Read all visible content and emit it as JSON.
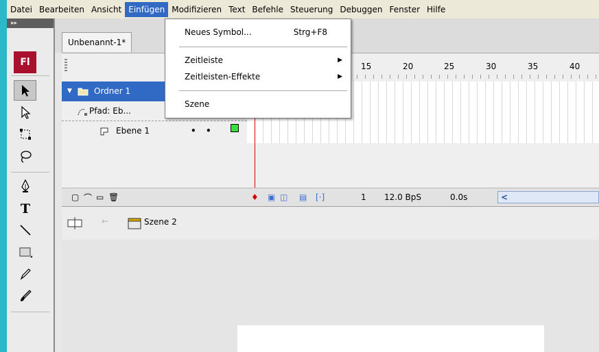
{
  "menubar": {
    "items": [
      "Datei",
      "Bearbeiten",
      "Ansicht",
      "Einfügen",
      "Modifizieren",
      "Text",
      "Befehle",
      "Steuerung",
      "Debuggen",
      "Fenster",
      "Hilfe"
    ],
    "active_index": 3
  },
  "dropdown": {
    "items": [
      {
        "label": "Neues Symbol...",
        "shortcut": "Strg+F8"
      },
      {
        "label": "Zeitleiste",
        "submenu": true
      },
      {
        "label": "Zeitleisten-Effekte",
        "submenu": true
      },
      {
        "label": "Szene"
      }
    ]
  },
  "toolbar": {
    "logo": "Fl",
    "tools": [
      "selection-arrow-icon",
      "subselection-arrow-icon",
      "free-transform-icon",
      "lasso-icon",
      "pen-icon",
      "text-icon",
      "line-icon",
      "rectangle-icon",
      "pencil-icon",
      "brush-icon"
    ]
  },
  "document_tab": {
    "title": "Unbenannt-1*"
  },
  "timeline": {
    "ruler": [
      "15",
      "20",
      "25",
      "30",
      "35",
      "40"
    ],
    "layers": [
      {
        "name": "Ordner 1",
        "type": "folder"
      },
      {
        "name": "Pfad: Eb...",
        "type": "guide"
      },
      {
        "name": "Ebene 1",
        "type": "layer"
      }
    ],
    "status": {
      "frame": "1",
      "fps": "12.0 BpS",
      "time": "0.0s"
    }
  },
  "scene_bar": {
    "scene_name": "Szene 2"
  },
  "colors": {
    "accent": "#316ac5",
    "keyframe": "#38e038",
    "logo_bg": "#a8102d",
    "playhead": "#d40000"
  }
}
